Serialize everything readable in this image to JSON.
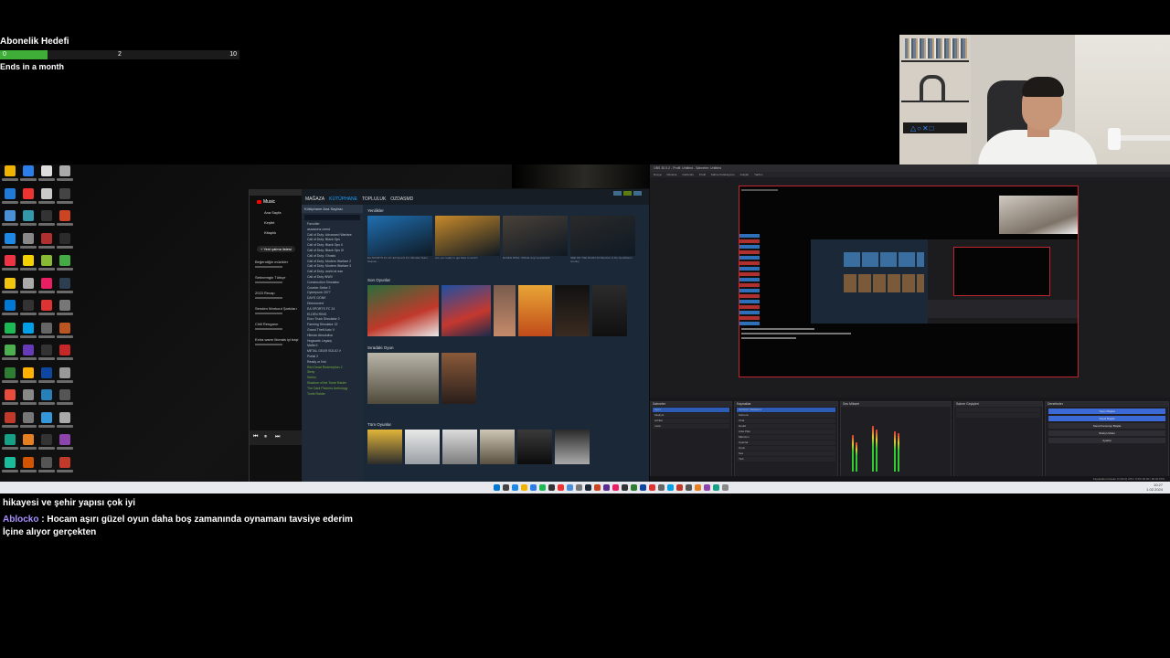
{
  "subgoal": {
    "title": "Abonelik Hedefi",
    "current": "0",
    "mid": "2",
    "target": "10",
    "progress_fraction": 0.2,
    "ends": "Ends in a month",
    "bar_color": "#3fae38"
  },
  "chat": {
    "lines": [
      {
        "user": "",
        "text": "hikayesi ve şehir yapısı çok iyi"
      },
      {
        "user": "Ablocko",
        "sep": " : ",
        "text": "Hocam aşırı güzel oyun daha boş zamanında oynamanı tavsiye ederim"
      },
      {
        "user": "",
        "text": "İçine alıyor gerçekten"
      }
    ],
    "user_color": "#a78fff"
  },
  "youtube": {
    "logo": "Music",
    "items": [
      "Ana Sayfa",
      "Keşfet",
      "Kitaplık"
    ],
    "new_playlist": "+ Yeni çalma listesi",
    "playlists": [
      "Beğendiğin müzikler",
      "Sebnemgin Türkçe",
      "2023 Recap",
      "Senden Workout Şarkıları",
      "Chill Rengarın",
      "Extra warm liberals iyi başl"
    ]
  },
  "steam": {
    "nav": [
      "MAĞAZA",
      "KÜTÜPHANE",
      "TOPLULUK",
      "OZDASMD"
    ],
    "active_nav": "KÜTÜPHANE",
    "sidebar_head": "Kütüphane Ana Sayfası",
    "sidebar_items": [
      "Favoriler",
      "assassins creed",
      "Call of Duty: Advanced Warfare",
      "Call of Duty: Black Ops",
      "Call of Duty: Black Ops II",
      "Call of Duty: Black Ops III",
      "Call of Duty: Ghosts",
      "Call of Duty: Modern Warfare 2",
      "Call of Duty: Modern Warfare 3",
      "Call of Duty: world at war",
      "Call of Duty WWII",
      "Construction Simulator",
      "Counter-Strike 2",
      "Cyberpunk 2077",
      "DAYS GONE",
      "Dishonored",
      "EA SPORTS FC 24",
      "ELDEN RING",
      "Euro Truck Simulator 2",
      "Farming Simulator 22",
      "Grand Theft Auto V",
      "Hitman Absolution",
      "Hogwarts Legacy",
      "Mafia II",
      "METAL GEAR SOLID V",
      "Portal 2",
      "Ready or Not",
      "Red Dead Redemption 2",
      "Stray",
      "Sekiro",
      "Shadow of the Tomb Raider",
      "The Dark Pictures Anthology",
      "Tomb Raider"
    ],
    "sec_new": "Yenilikler",
    "news": [
      {
        "caption": "EA SPORTS FC 24: EA Sports FC Ultimate Team Season...",
        "color": "#1f6fb2"
      },
      {
        "caption": "Are you ready to get back to work?",
        "color": "#c78a2a"
      },
      {
        "caption": "ELDEN RING: Official vinyl soundtrack",
        "color": "#4a4138"
      },
      {
        "caption": "SEE ON THE ROAD 24! Election & the Gendbaum country",
        "color": "#2a2a2a"
      }
    ],
    "sec_recent": "Son Oyunlar",
    "sec_play": "Sıradaki Oyun",
    "sec_all": "Tüm Oyunlar",
    "cod_label": "CALL·DUTY",
    "cod_waw": "CALL OF DUTY WORLD AT WAR"
  },
  "obs": {
    "title": "OBS 30.0.2 - Profil: Untitled - Sahneler: Untitled",
    "menu": [
      "Dosya",
      "Düzenle",
      "Görünüm",
      "Profil",
      "Sahne Koleksiyonu",
      "Araçlar",
      "Yardım"
    ],
    "docks": [
      "Sahneler",
      "Kaynaklar",
      "Ses Mikseri",
      "Sahne Geçişleri",
      "Denetimler"
    ],
    "scenes": [
      "oyun",
      "başlıyor",
      "sohbet",
      "mola"
    ],
    "sources": [
      "Görüntü Yakalama",
      "Kamera",
      "Chat",
      "Hedef",
      "Arka Plan",
      "Mikrofon",
      "Uyarılar",
      "Oyun",
      "Ses",
      "Yazı"
    ],
    "controls": [
      "Yayını Başlat",
      "Kaydı Başlat",
      "Sanal Kamerayı Başlat",
      "Stüdyo Modu",
      "Ayarlar"
    ],
    "status": "Kaydedilen Kareler 0 (%0.0)   CPU: 6.9%   60.00 / 60.00 FPS"
  },
  "taskbar": {
    "clock": "10:27",
    "date": "1.02.2024"
  }
}
